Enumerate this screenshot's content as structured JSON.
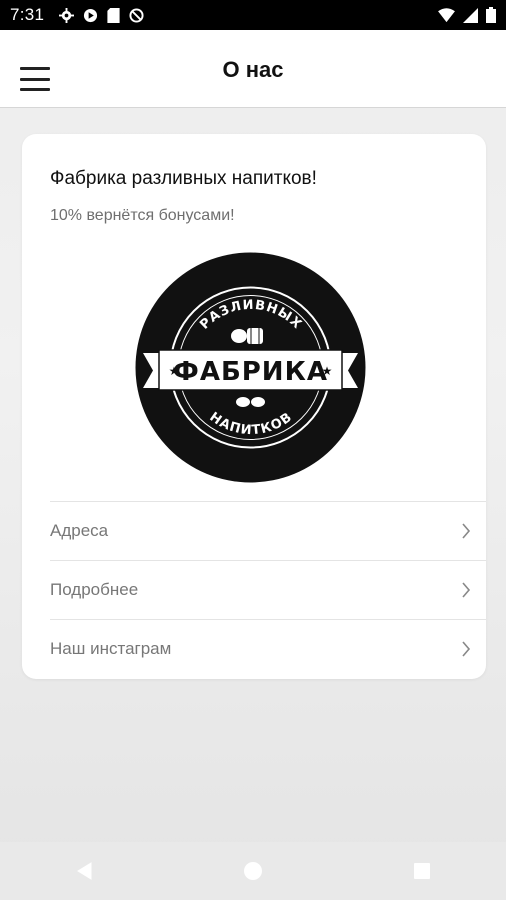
{
  "status_bar": {
    "time": "7:31",
    "icons_left": [
      "gear-icon",
      "play-icon",
      "sd-card-icon",
      "no-sync-icon"
    ],
    "icons_right": [
      "wifi-icon",
      "signal-icon",
      "battery-icon"
    ]
  },
  "app_bar": {
    "title": "О нас",
    "menu_icon": "hamburger-menu-icon"
  },
  "card": {
    "title": "Фабрика разливных напитков!",
    "subtitle": "10% вернётся бонусами!",
    "logo": {
      "top_text": "РАЗЛИВНЫХ",
      "center_text": "ФАБРИКА",
      "bottom_text": "НАПИТКОВ",
      "colors": {
        "background": "#111111",
        "foreground": "#ffffff"
      }
    },
    "items": [
      {
        "label": "Адреса"
      },
      {
        "label": "Подробнее"
      },
      {
        "label": "Наш инстаграм"
      }
    ]
  },
  "nav_bar": {
    "buttons": [
      "back-icon",
      "home-icon",
      "recents-icon"
    ]
  },
  "colors": {
    "status_bar": "#000000",
    "app_bar": "#ffffff",
    "background": "#ececec",
    "card": "#ffffff",
    "muted_text": "#777777"
  }
}
